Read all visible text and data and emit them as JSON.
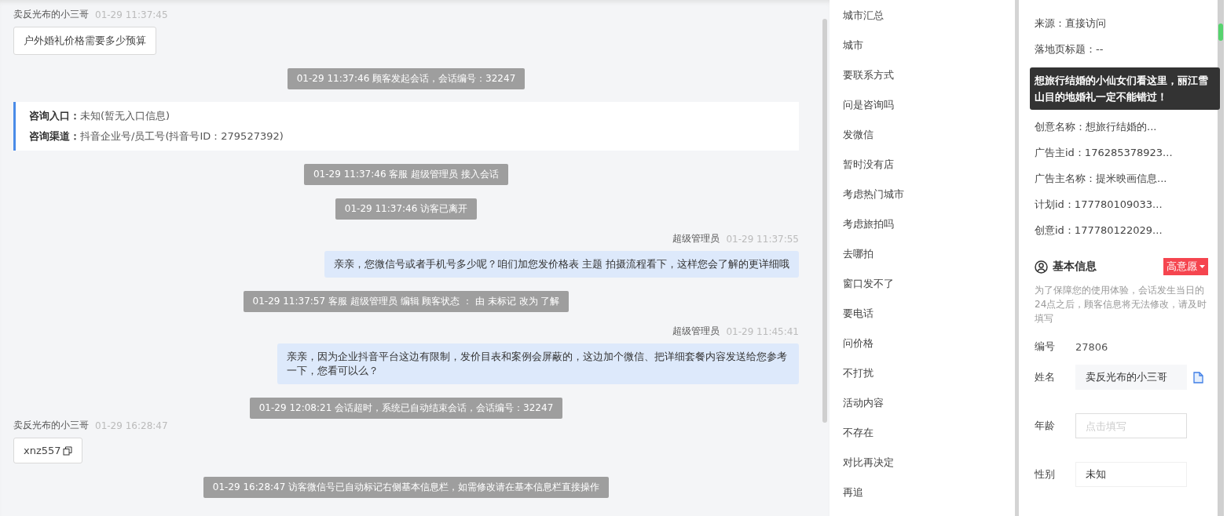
{
  "chat": {
    "messages": [
      {
        "kind": "visitor",
        "name": "卖反光布的小三哥",
        "time": "01-29 11:37:45",
        "text": "户外婚礼价格需要多少预算",
        "copyable": false
      },
      {
        "kind": "system",
        "text": "01-29 11:37:46 顾客发起会话，会话编号：32247"
      },
      {
        "kind": "card",
        "rows": [
          {
            "label": "咨询入口：",
            "value": "未知(暂无入口信息)"
          },
          {
            "label": "咨询渠道：",
            "value": "抖音企业号/员工号(抖音号ID：279527392)"
          }
        ]
      },
      {
        "kind": "system",
        "text": "01-29 11:37:46 客服 超级管理员 接入会话"
      },
      {
        "kind": "system",
        "text": "01-29 11:37:46 访客已离开"
      },
      {
        "kind": "agent",
        "name": "超级管理员",
        "time": "01-29 11:37:55",
        "text": "亲亲，您微信号或者手机号多少呢？咱们加您发价格表 主题 拍摄流程看下，这样您会了解的更详细哦"
      },
      {
        "kind": "system",
        "text": "01-29 11:37:57 客服 超级管理员 编辑 顾客状态 ： 由 未标记 改为 了解"
      },
      {
        "kind": "agent",
        "name": "超级管理员",
        "time": "01-29 11:45:41",
        "text": "亲亲，因为企业抖音平台这边有限制，发价目表和案例会屏蔽的，这边加个微信、把详细套餐内容发送给您参考一下，您看可以么？"
      },
      {
        "kind": "system",
        "text": "01-29 12:08:21 会话超时，系统已自动结束会话，会话编号：32247"
      },
      {
        "kind": "visitor",
        "name": "卖反光布的小三哥",
        "time": "01-29 16:28:47",
        "text": "xnz557",
        "copyable": true
      },
      {
        "kind": "system",
        "text": "01-29 16:28:47 访客微信号已自动标记右侧基本信息栏，如需修改请在基本信息栏直接操作"
      }
    ]
  },
  "quick_replies": [
    "城市汇总",
    "城市",
    "要联系方式",
    "问是咨询吗",
    "发微信",
    "暂时没有店",
    "考虑热门城市",
    "考虑旅拍吗",
    "去哪拍",
    "窗口发不了",
    "要电话",
    "问价格",
    "不打扰",
    "活动内容",
    "不存在",
    "对比再决定",
    "再追"
  ],
  "source_info": {
    "top_items": [
      "来源：直接访问",
      "落地页标题：--"
    ],
    "tooltip": "想旅行结婚的小仙女们看这里，丽江雪山目的地婚礼一定不能错过！",
    "items": [
      "创意名称：想旅行结婚的...",
      "广告主id：176285378923...",
      "广告主名称：提米映画信息...",
      "计划id：177780109033...",
      "创意id：177780122029..."
    ]
  },
  "basic_info": {
    "title": "基本信息",
    "intent_tag": "高意愿",
    "notice": "为了保障您的使用体验，会话发生当日的24点之后，顾客信息将无法修改，请及时填写",
    "fields": [
      {
        "kind": "text",
        "label": "编号",
        "value": "27806"
      },
      {
        "kind": "copy",
        "label": "姓名",
        "value": "卖反光布的小三哥"
      },
      {
        "kind": "input",
        "label": "年龄",
        "placeholder": "点击填写"
      },
      {
        "kind": "select",
        "label": "性别",
        "value": "未知"
      }
    ]
  }
}
